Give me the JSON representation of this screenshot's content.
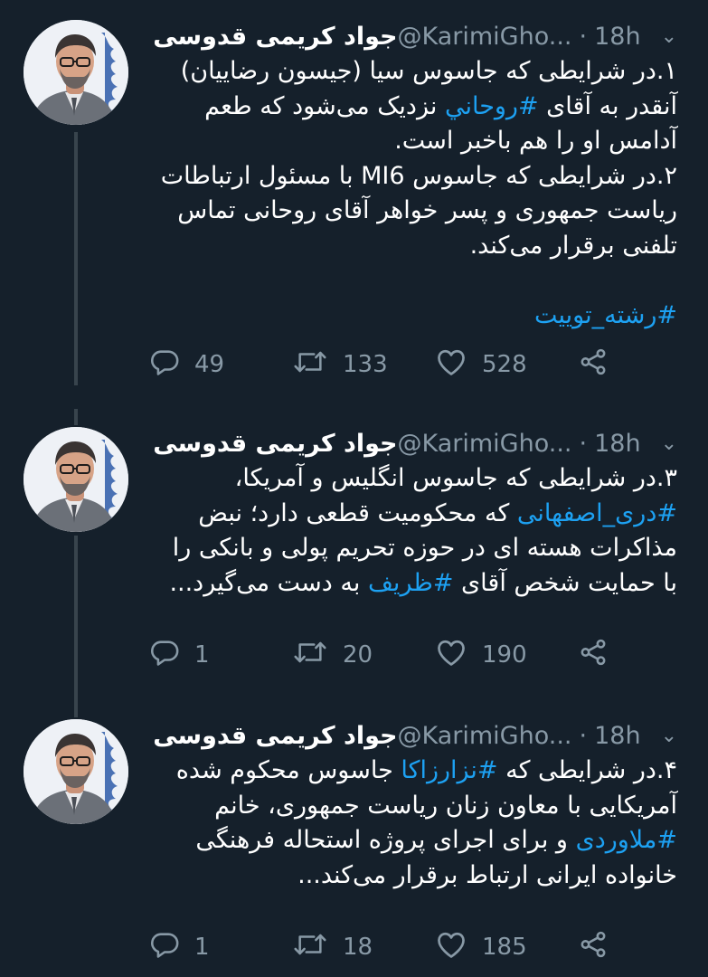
{
  "tweets": [
    {
      "name": "جواد کریمی قدوسی",
      "handle": "@KarimiGho...",
      "dot": "·",
      "time": "18h",
      "body_lines": [
        [
          "۱.در شرایطی که جاسوس سیا (جیسون رضاییان)"
        ],
        [
          "آنقدر به آقای ",
          {
            "tag": "#روحاني"
          },
          " نزدیک می‌شود که طعم"
        ],
        [
          "آدامس او را هم باخبر است."
        ],
        [
          "۲.در شرایطی که جاسوس MI6 با مسئول ارتباطات"
        ],
        [
          "ریاست جمهوری و پسر خواهر آقای روحانی تماس"
        ],
        [
          "تلفنی برقرار می‌کند."
        ],
        [
          ""
        ],
        [
          {
            "tag": "#رشته_توییت"
          }
        ]
      ],
      "replies": "49",
      "retweets": "133",
      "likes": "528"
    },
    {
      "name": "جواد کریمی قدوسی",
      "handle": "@KarimiGho...",
      "dot": "·",
      "time": "18h",
      "body_lines": [
        [
          "۳.در شرایطی که جاسوس انگلیس و آمریکا،"
        ],
        [
          {
            "tag": "#دری_اصفهانی"
          },
          " که محکومیت قطعی دارد؛ نبض"
        ],
        [
          "مذاکرات هسته ای در حوزه تحریم پولی و بانکی را"
        ],
        [
          "با حمایت شخص آقای ",
          {
            "tag": "#ظریف"
          },
          " به دست می‌گیرد..."
        ]
      ],
      "replies": "1",
      "retweets": "20",
      "likes": "190"
    },
    {
      "name": "جواد کریمی قدوسی",
      "handle": "@KarimiGho...",
      "dot": "·",
      "time": "18h",
      "body_lines": [
        [
          "۴.در شرایطی که ",
          {
            "tag": "#نزارزاکا"
          },
          " جاسوس محکوم شده"
        ],
        [
          "آمریکایی با معاون زنان ریاست جمهوری، خانم"
        ],
        [
          {
            "tag": "#ملاوردی"
          },
          " و برای اجرای پروژه استحاله فرهنگی"
        ],
        [
          "خانواده ایرانی ارتباط برقرار می‌کند..."
        ]
      ],
      "replies": "1",
      "retweets": "18",
      "likes": "185"
    }
  ],
  "icons": {
    "reply": "reply-icon",
    "retweet": "retweet-icon",
    "like": "heart-icon",
    "share": "share-icon",
    "more": "chevron-down-icon"
  },
  "colors": {
    "background": "#15202b",
    "hashtag": "#1da1f2",
    "muted": "#8899a6",
    "thread_line": "#38444d"
  }
}
